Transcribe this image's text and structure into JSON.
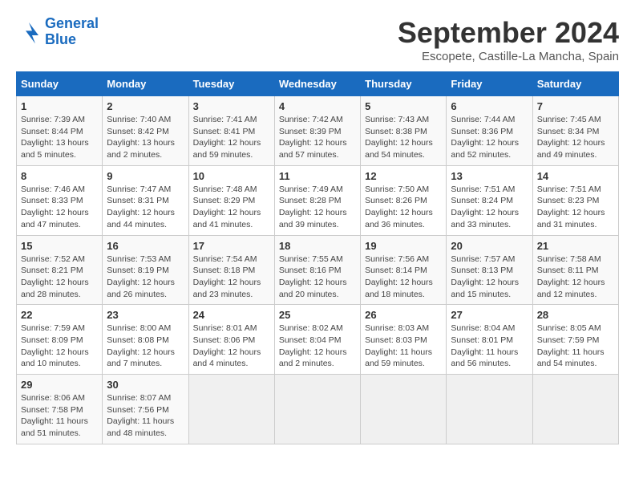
{
  "header": {
    "logo_line1": "General",
    "logo_line2": "Blue",
    "month_title": "September 2024",
    "location": "Escopete, Castille-La Mancha, Spain"
  },
  "days_of_week": [
    "Sunday",
    "Monday",
    "Tuesday",
    "Wednesday",
    "Thursday",
    "Friday",
    "Saturday"
  ],
  "weeks": [
    [
      {
        "day": "1",
        "sunrise": "7:39 AM",
        "sunset": "8:44 PM",
        "daylight": "13 hours and 5 minutes."
      },
      {
        "day": "2",
        "sunrise": "7:40 AM",
        "sunset": "8:42 PM",
        "daylight": "13 hours and 2 minutes."
      },
      {
        "day": "3",
        "sunrise": "7:41 AM",
        "sunset": "8:41 PM",
        "daylight": "12 hours and 59 minutes."
      },
      {
        "day": "4",
        "sunrise": "7:42 AM",
        "sunset": "8:39 PM",
        "daylight": "12 hours and 57 minutes."
      },
      {
        "day": "5",
        "sunrise": "7:43 AM",
        "sunset": "8:38 PM",
        "daylight": "12 hours and 54 minutes."
      },
      {
        "day": "6",
        "sunrise": "7:44 AM",
        "sunset": "8:36 PM",
        "daylight": "12 hours and 52 minutes."
      },
      {
        "day": "7",
        "sunrise": "7:45 AM",
        "sunset": "8:34 PM",
        "daylight": "12 hours and 49 minutes."
      }
    ],
    [
      {
        "day": "8",
        "sunrise": "7:46 AM",
        "sunset": "8:33 PM",
        "daylight": "12 hours and 47 minutes."
      },
      {
        "day": "9",
        "sunrise": "7:47 AM",
        "sunset": "8:31 PM",
        "daylight": "12 hours and 44 minutes."
      },
      {
        "day": "10",
        "sunrise": "7:48 AM",
        "sunset": "8:29 PM",
        "daylight": "12 hours and 41 minutes."
      },
      {
        "day": "11",
        "sunrise": "7:49 AM",
        "sunset": "8:28 PM",
        "daylight": "12 hours and 39 minutes."
      },
      {
        "day": "12",
        "sunrise": "7:50 AM",
        "sunset": "8:26 PM",
        "daylight": "12 hours and 36 minutes."
      },
      {
        "day": "13",
        "sunrise": "7:51 AM",
        "sunset": "8:24 PM",
        "daylight": "12 hours and 33 minutes."
      },
      {
        "day": "14",
        "sunrise": "7:51 AM",
        "sunset": "8:23 PM",
        "daylight": "12 hours and 31 minutes."
      }
    ],
    [
      {
        "day": "15",
        "sunrise": "7:52 AM",
        "sunset": "8:21 PM",
        "daylight": "12 hours and 28 minutes."
      },
      {
        "day": "16",
        "sunrise": "7:53 AM",
        "sunset": "8:19 PM",
        "daylight": "12 hours and 26 minutes."
      },
      {
        "day": "17",
        "sunrise": "7:54 AM",
        "sunset": "8:18 PM",
        "daylight": "12 hours and 23 minutes."
      },
      {
        "day": "18",
        "sunrise": "7:55 AM",
        "sunset": "8:16 PM",
        "daylight": "12 hours and 20 minutes."
      },
      {
        "day": "19",
        "sunrise": "7:56 AM",
        "sunset": "8:14 PM",
        "daylight": "12 hours and 18 minutes."
      },
      {
        "day": "20",
        "sunrise": "7:57 AM",
        "sunset": "8:13 PM",
        "daylight": "12 hours and 15 minutes."
      },
      {
        "day": "21",
        "sunrise": "7:58 AM",
        "sunset": "8:11 PM",
        "daylight": "12 hours and 12 minutes."
      }
    ],
    [
      {
        "day": "22",
        "sunrise": "7:59 AM",
        "sunset": "8:09 PM",
        "daylight": "12 hours and 10 minutes."
      },
      {
        "day": "23",
        "sunrise": "8:00 AM",
        "sunset": "8:08 PM",
        "daylight": "12 hours and 7 minutes."
      },
      {
        "day": "24",
        "sunrise": "8:01 AM",
        "sunset": "8:06 PM",
        "daylight": "12 hours and 4 minutes."
      },
      {
        "day": "25",
        "sunrise": "8:02 AM",
        "sunset": "8:04 PM",
        "daylight": "12 hours and 2 minutes."
      },
      {
        "day": "26",
        "sunrise": "8:03 AM",
        "sunset": "8:03 PM",
        "daylight": "11 hours and 59 minutes."
      },
      {
        "day": "27",
        "sunrise": "8:04 AM",
        "sunset": "8:01 PM",
        "daylight": "11 hours and 56 minutes."
      },
      {
        "day": "28",
        "sunrise": "8:05 AM",
        "sunset": "7:59 PM",
        "daylight": "11 hours and 54 minutes."
      }
    ],
    [
      {
        "day": "29",
        "sunrise": "8:06 AM",
        "sunset": "7:58 PM",
        "daylight": "11 hours and 51 minutes."
      },
      {
        "day": "30",
        "sunrise": "8:07 AM",
        "sunset": "7:56 PM",
        "daylight": "11 hours and 48 minutes."
      },
      null,
      null,
      null,
      null,
      null
    ]
  ],
  "labels": {
    "sunrise_prefix": "Sunrise: ",
    "sunset_prefix": "Sunset: ",
    "daylight_prefix": "Daylight: "
  }
}
